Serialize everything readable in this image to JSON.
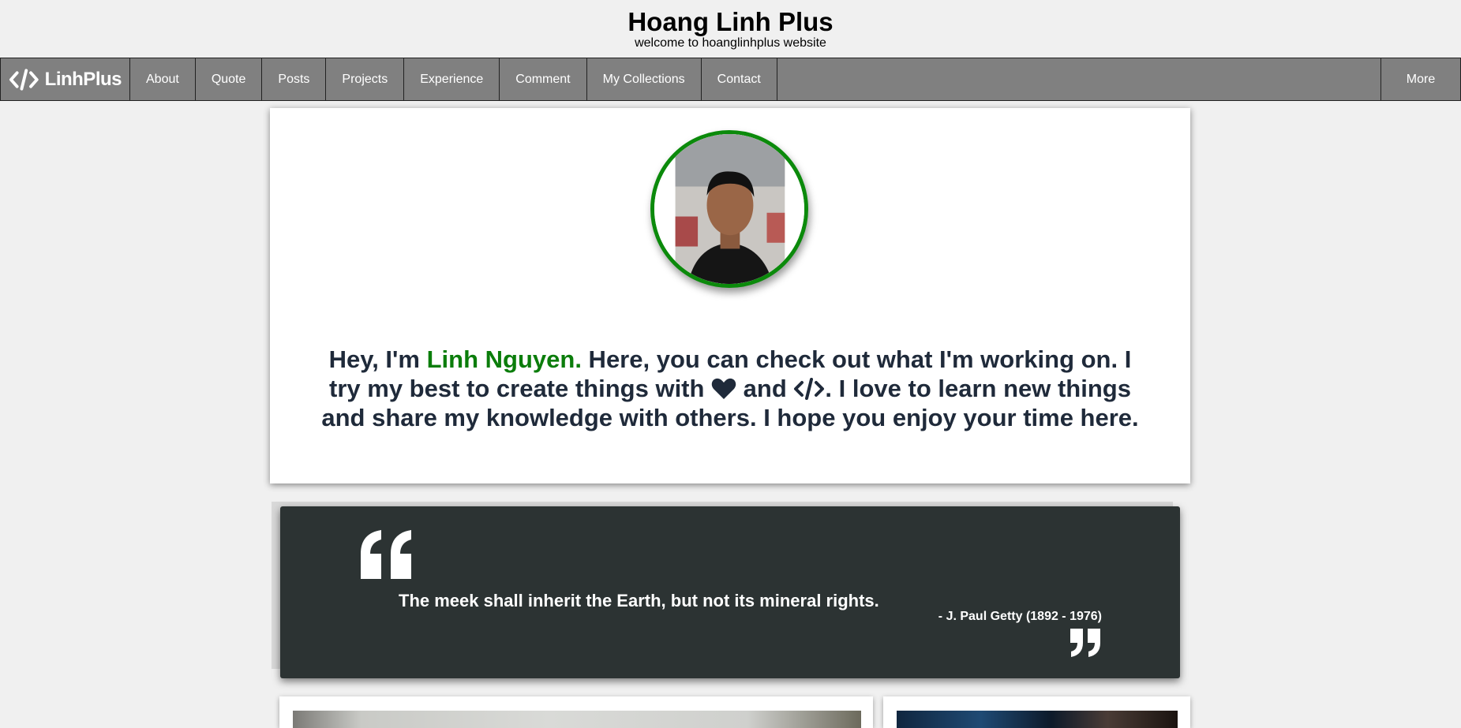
{
  "header": {
    "title": "Hoang Linh Plus",
    "subtitle": "welcome to hoanglinhplus website"
  },
  "nav": {
    "brand": "LinhPlus",
    "items": [
      {
        "label": "About"
      },
      {
        "label": "Quote"
      },
      {
        "label": "Posts"
      },
      {
        "label": "Projects"
      },
      {
        "label": "Experience"
      },
      {
        "label": "Comment"
      },
      {
        "label": "My Collections"
      },
      {
        "label": "Contact"
      }
    ],
    "more": "More"
  },
  "about": {
    "avatar_icon": "profile-photo",
    "intro_before": "Hey, I'm ",
    "name": "Linh Nguyen.",
    "intro_middle": " Here, you can check out what I'm working on. I try my best to create things with ",
    "and_text": " and ",
    "intro_after": ". I love to learn new things and share my knowledge with others. I hope you enjoy your time here.",
    "heart_icon": "heart-icon",
    "code_icon": "code-icon",
    "accent_color": "#0b7d0b"
  },
  "quote": {
    "text": "The meek shall inherit the Earth, but not its mineral rights.",
    "author": "- J. Paul Getty (1892 - 1976)",
    "open_icon": "quote-open-icon",
    "close_icon": "quote-close-icon",
    "background": "#2c3333"
  },
  "colors": {
    "nav_background": "#808080",
    "page_background": "#f0f0f0",
    "avatar_border": "#0b8a0b"
  }
}
